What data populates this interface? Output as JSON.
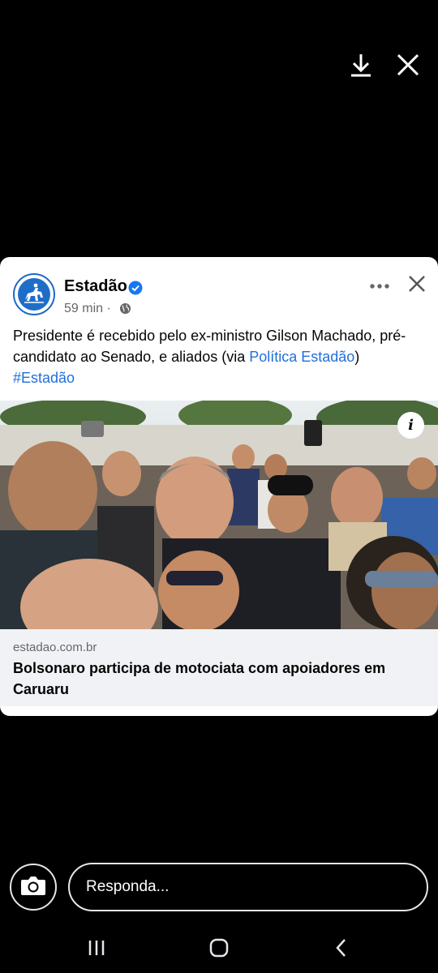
{
  "viewer": {
    "download_icon": "download-icon",
    "close_icon": "close-icon"
  },
  "post": {
    "page_name": "Estadão",
    "verified_icon": "verified-badge-icon",
    "time": "59 min",
    "separator": "·",
    "audience_icon": "globe-icon",
    "more_icon": "more-options-icon",
    "text_part1": "Presidente é recebido pelo ex-ministro Gilson Machado, pré-candidato ao Senado, e aliados (via ",
    "text_link": "Política Estadão",
    "text_part2": ")",
    "hashtag": "#Estadão",
    "link_domain": "estadao.com.br",
    "link_headline": "Bolsonaro participa de motociata com apoiadores em Caruaru",
    "info_label": "i"
  },
  "reply": {
    "placeholder": "Responda...",
    "camera_icon": "camera-icon"
  },
  "navbar": {
    "recents_icon": "recents-icon",
    "home_icon": "home-icon",
    "back_icon": "back-icon"
  },
  "colors": {
    "background": "#000000",
    "card": "#ffffff",
    "link": "#216fdb",
    "secondary_text": "#65676b",
    "preview_bg": "#f0f2f5"
  }
}
